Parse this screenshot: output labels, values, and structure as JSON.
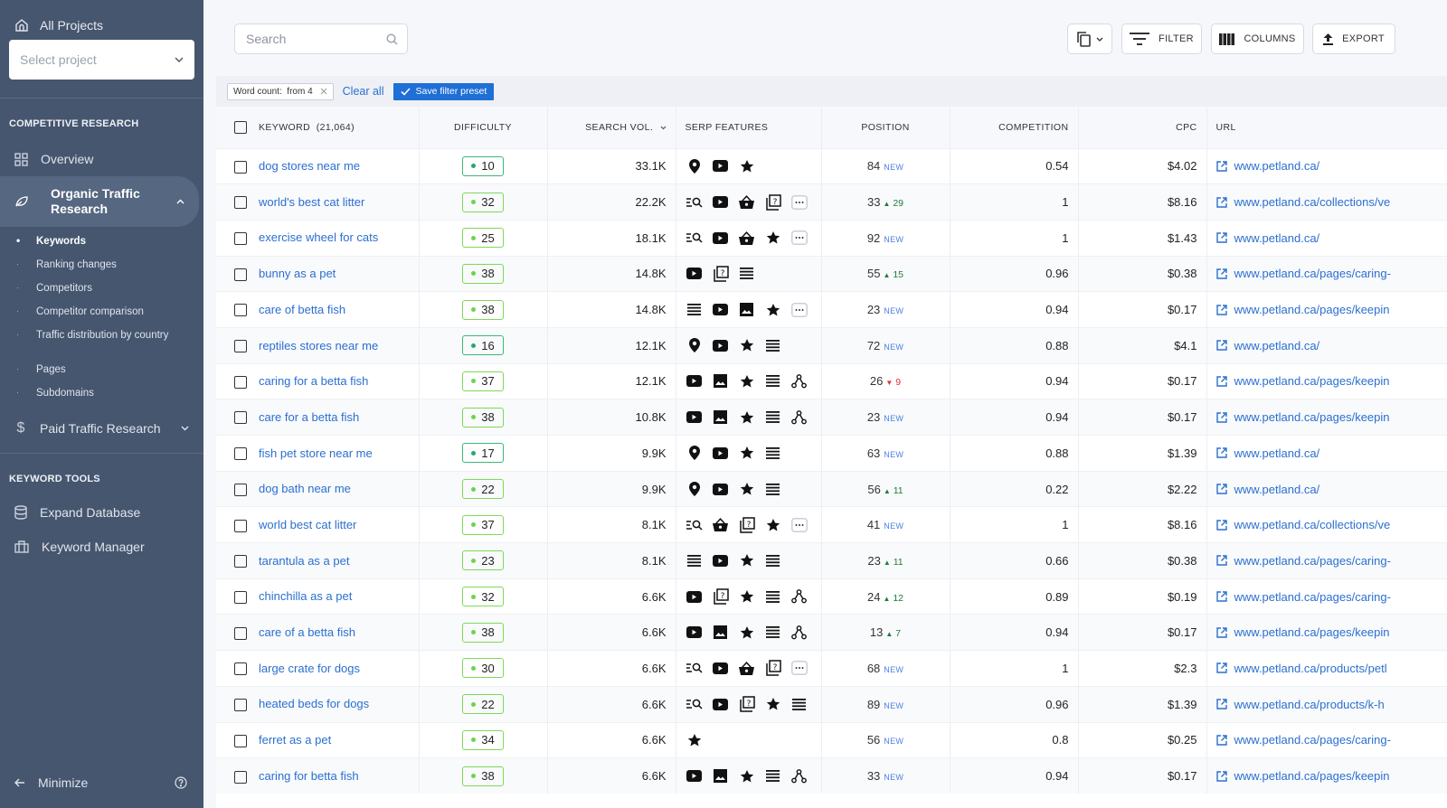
{
  "sidebar": {
    "all_projects": "All Projects",
    "select_project_placeholder": "Select project",
    "section_competitive": "COMPETITIVE RESEARCH",
    "overview": "Overview",
    "organic": "Organic Traffic Research",
    "sub_items": [
      "Keywords",
      "Ranking changes",
      "Competitors",
      "Competitor comparison",
      "Traffic distribution by country",
      "Pages",
      "Subdomains"
    ],
    "paid": "Paid Traffic Research",
    "section_tools": "KEYWORD TOOLS",
    "expand_db": "Expand Database",
    "kw_manager": "Keyword Manager",
    "minimize": "Minimize"
  },
  "toolbar": {
    "search_placeholder": "Search",
    "filter": "FILTER",
    "columns": "COLUMNS",
    "export": "EXPORT"
  },
  "filters": {
    "chip": "Word count:  from 4",
    "clear_all": "Clear all",
    "save_preset": "Save filter preset"
  },
  "table": {
    "headers": {
      "keyword": "KEYWORD",
      "keyword_count": "(21,064)",
      "difficulty": "DIFFICULTY",
      "search_vol": "SEARCH VOL.",
      "serp": "SERP FEATURES",
      "position": "POSITION",
      "competition": "COMPETITION",
      "cpc": "CPC",
      "url": "URL"
    },
    "rows": [
      {
        "keyword": "dog stores near me",
        "difficulty": 10,
        "vol": "33.1K",
        "serp": [
          "pin",
          "video",
          "star"
        ],
        "pos": "84",
        "change": "new",
        "comp": "0.54",
        "cpc": "$4.02",
        "url": "www.petland.ca/"
      },
      {
        "keyword": "world's best cat litter",
        "difficulty": 32,
        "vol": "22.2K",
        "serp": [
          "list-search",
          "video",
          "basket",
          "faq",
          "more"
        ],
        "pos": "33",
        "change": "up",
        "delta": "29",
        "comp": "1",
        "cpc": "$8.16",
        "url": "www.petland.ca/collections/ve"
      },
      {
        "keyword": "exercise wheel for cats",
        "difficulty": 25,
        "vol": "18.1K",
        "serp": [
          "list-search",
          "video",
          "basket",
          "star",
          "more"
        ],
        "pos": "92",
        "change": "new",
        "comp": "1",
        "cpc": "$1.43",
        "url": "www.petland.ca/"
      },
      {
        "keyword": "bunny as a pet",
        "difficulty": 38,
        "vol": "14.8K",
        "serp": [
          "video",
          "faq",
          "lines"
        ],
        "pos": "55",
        "change": "up",
        "delta": "15",
        "comp": "0.96",
        "cpc": "$0.38",
        "url": "www.petland.ca/pages/caring-"
      },
      {
        "keyword": "care of betta fish",
        "difficulty": 38,
        "vol": "14.8K",
        "serp": [
          "lines",
          "video",
          "image",
          "star",
          "more"
        ],
        "pos": "23",
        "change": "new",
        "comp": "0.94",
        "cpc": "$0.17",
        "url": "www.petland.ca/pages/keepin"
      },
      {
        "keyword": "reptiles stores near me",
        "difficulty": 16,
        "vol": "12.1K",
        "serp": [
          "pin",
          "video",
          "star",
          "lines"
        ],
        "pos": "72",
        "change": "new",
        "comp": "0.88",
        "cpc": "$4.1",
        "url": "www.petland.ca/"
      },
      {
        "keyword": "caring for a betta fish",
        "difficulty": 37,
        "vol": "12.1K",
        "serp": [
          "video",
          "image",
          "star",
          "lines",
          "graph"
        ],
        "pos": "26",
        "change": "down",
        "delta": "9",
        "comp": "0.94",
        "cpc": "$0.17",
        "url": "www.petland.ca/pages/keepin"
      },
      {
        "keyword": "care for a betta fish",
        "difficulty": 38,
        "vol": "10.8K",
        "serp": [
          "video",
          "image",
          "star",
          "lines",
          "graph"
        ],
        "pos": "23",
        "change": "new",
        "comp": "0.94",
        "cpc": "$0.17",
        "url": "www.petland.ca/pages/keepin"
      },
      {
        "keyword": "fish pet store near me",
        "difficulty": 17,
        "vol": "9.9K",
        "serp": [
          "pin",
          "video",
          "star",
          "lines"
        ],
        "pos": "63",
        "change": "new",
        "comp": "0.88",
        "cpc": "$1.39",
        "url": "www.petland.ca/"
      },
      {
        "keyword": "dog bath near me",
        "difficulty": 22,
        "vol": "9.9K",
        "serp": [
          "pin",
          "video",
          "star",
          "lines"
        ],
        "pos": "56",
        "change": "up",
        "delta": "11",
        "comp": "0.22",
        "cpc": "$2.22",
        "url": "www.petland.ca/"
      },
      {
        "keyword": "world best cat litter",
        "difficulty": 37,
        "vol": "8.1K",
        "serp": [
          "list-search",
          "basket",
          "faq",
          "star",
          "more"
        ],
        "pos": "41",
        "change": "new",
        "comp": "1",
        "cpc": "$8.16",
        "url": "www.petland.ca/collections/ve"
      },
      {
        "keyword": "tarantula as a pet",
        "difficulty": 23,
        "vol": "8.1K",
        "serp": [
          "lines",
          "video",
          "star",
          "lines"
        ],
        "pos": "23",
        "change": "up",
        "delta": "11",
        "comp": "0.66",
        "cpc": "$0.38",
        "url": "www.petland.ca/pages/caring-"
      },
      {
        "keyword": "chinchilla as a pet",
        "difficulty": 32,
        "vol": "6.6K",
        "serp": [
          "video",
          "faq",
          "star",
          "lines",
          "graph"
        ],
        "pos": "24",
        "change": "up",
        "delta": "12",
        "comp": "0.89",
        "cpc": "$0.19",
        "url": "www.petland.ca/pages/caring-"
      },
      {
        "keyword": "care of a betta fish",
        "difficulty": 38,
        "vol": "6.6K",
        "serp": [
          "video",
          "image",
          "star",
          "lines",
          "graph"
        ],
        "pos": "13",
        "change": "up",
        "delta": "7",
        "comp": "0.94",
        "cpc": "$0.17",
        "url": "www.petland.ca/pages/keepin"
      },
      {
        "keyword": "large crate for dogs",
        "difficulty": 30,
        "vol": "6.6K",
        "serp": [
          "list-search",
          "video",
          "basket",
          "faq",
          "more"
        ],
        "pos": "68",
        "change": "new",
        "comp": "1",
        "cpc": "$2.3",
        "url": "www.petland.ca/products/petl"
      },
      {
        "keyword": "heated beds for dogs",
        "difficulty": 22,
        "vol": "6.6K",
        "serp": [
          "list-search",
          "video",
          "faq",
          "star",
          "lines"
        ],
        "pos": "89",
        "change": "new",
        "comp": "0.96",
        "cpc": "$1.39",
        "url": "www.petland.ca/products/k-h"
      },
      {
        "keyword": "ferret as a pet",
        "difficulty": 34,
        "vol": "6.6K",
        "serp": [
          "star"
        ],
        "pos": "56",
        "change": "new",
        "comp": "0.8",
        "cpc": "$0.25",
        "url": "www.petland.ca/pages/caring-"
      },
      {
        "keyword": "caring for betta fish",
        "difficulty": 38,
        "vol": "6.6K",
        "serp": [
          "video",
          "image",
          "star",
          "lines",
          "graph"
        ],
        "pos": "33",
        "change": "new",
        "comp": "0.94",
        "cpc": "$0.17",
        "url": "www.petland.ca/pages/keepin"
      }
    ],
    "new_label": "NEW"
  },
  "colors": {
    "sidebar_bg": "#46566f",
    "link": "#2b6fd0",
    "accent": "#1e6fd6",
    "diff_green": "#6fd34a",
    "up": "#1f7a3e",
    "down": "#e03131"
  }
}
